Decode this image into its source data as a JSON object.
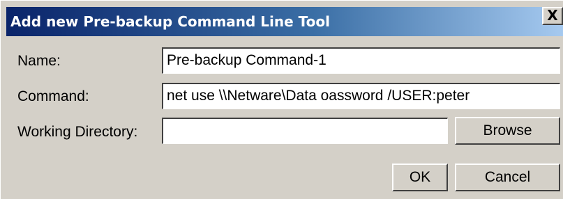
{
  "dialog": {
    "title": "Add new Pre-backup Command Line Tool",
    "close_glyph": "X"
  },
  "form": {
    "name_label": "Name:",
    "name_value": "Pre-backup Command-1",
    "command_label": "Command:",
    "command_value": "net use \\\\Netware\\Data oassword /USER:peter",
    "workdir_label": "Working Directory:",
    "workdir_value": "",
    "browse_label": "Browse"
  },
  "buttons": {
    "ok_label": "OK",
    "cancel_label": "Cancel"
  }
}
